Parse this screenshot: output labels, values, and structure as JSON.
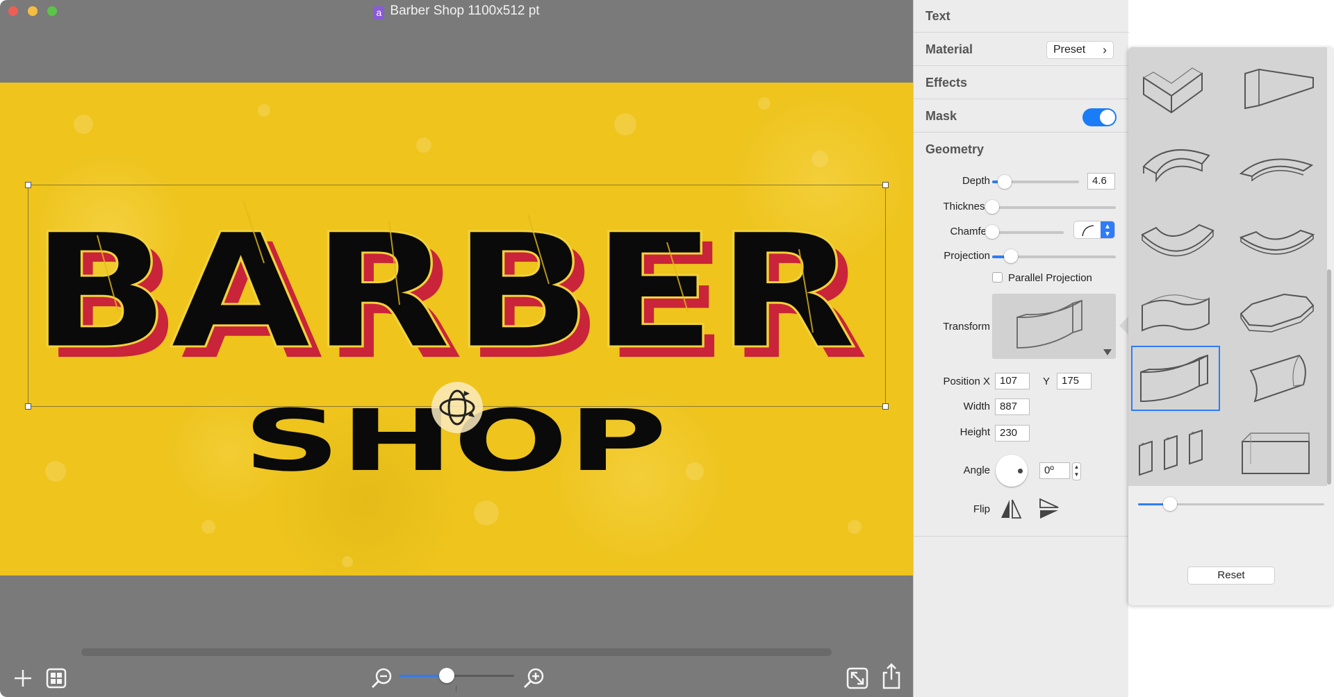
{
  "window": {
    "doc_icon_letter": "a",
    "title": "Barber Shop 1100x512 pt"
  },
  "canvas": {
    "headline": "BARBER",
    "subline": "SHOP",
    "colors": {
      "background": "#eec41d",
      "text": "#0a0a0a",
      "extrude": "#c9243a"
    }
  },
  "inspector": {
    "sections": {
      "text": "Text",
      "material": "Material",
      "preset_label": "Preset",
      "effects": "Effects",
      "mask": "Mask",
      "geometry": "Geometry"
    },
    "mask_enabled": true,
    "geometry": {
      "depth_label": "Depth",
      "depth_value": "4.6",
      "depth_level": 0.14,
      "thickness_label": "Thickness",
      "thickness_level": 0.0,
      "chamfer_label": "Chamfer",
      "chamfer_level": 0.0,
      "projection_label": "Projection",
      "projection_level": 0.15,
      "parallel_projection_label": "Parallel Projection",
      "parallel_projection_checked": false,
      "transform_label": "Transform",
      "position_x_label": "Position X",
      "position_x": "107",
      "position_y_label": "Y",
      "position_y": "175",
      "width_label": "Width",
      "width": "887",
      "height_label": "Height",
      "height": "230",
      "angle_label": "Angle",
      "angle": "0º",
      "flip_label": "Flip"
    }
  },
  "popover": {
    "selected_shape": 8,
    "shapes": [
      "fold-v",
      "wedge",
      "arch",
      "arch-thin",
      "valley",
      "valley-thin",
      "wave",
      "octagon",
      "curved-panel",
      "cylinder-panel",
      "three-panels",
      "box"
    ],
    "slider_level": 0.17,
    "reset_label": "Reset"
  },
  "toolbar": {
    "zoom_level": 0.41
  }
}
